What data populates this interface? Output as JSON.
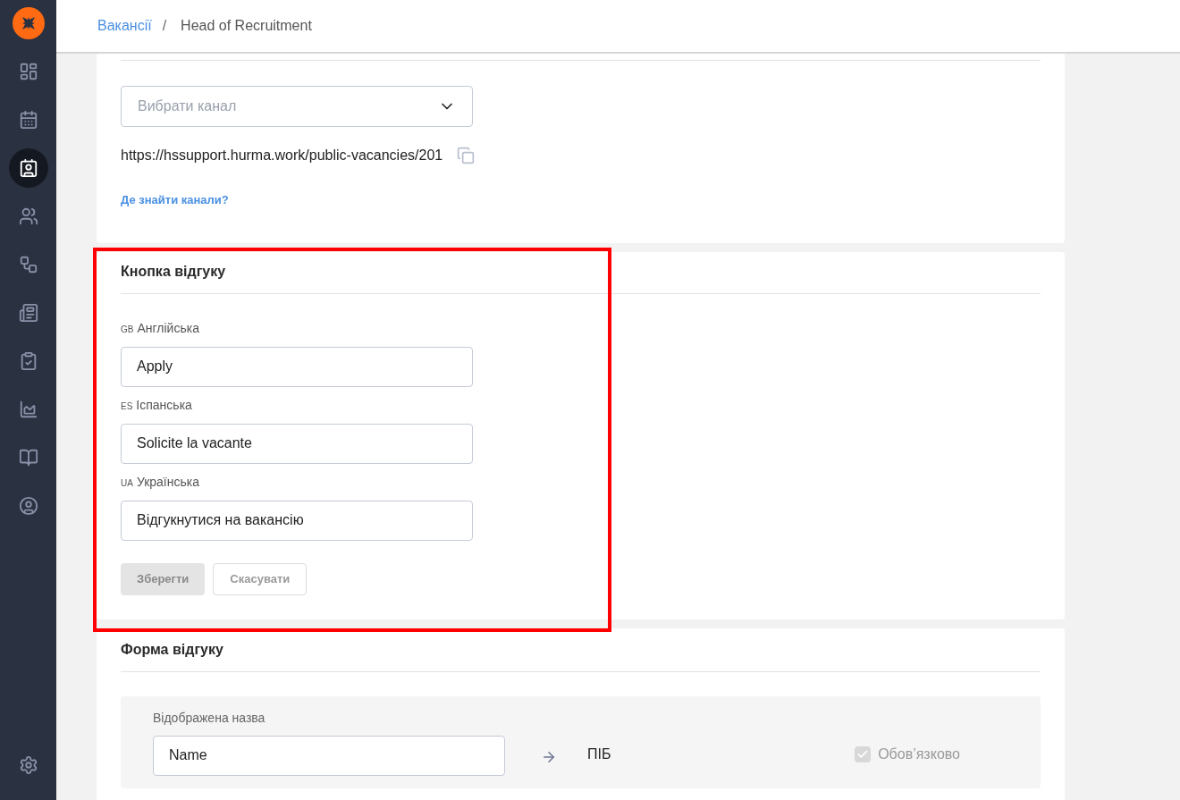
{
  "sidebar": {
    "items": [
      {
        "selected": false
      },
      {
        "selected": false
      },
      {
        "selected": true
      },
      {
        "selected": false
      },
      {
        "selected": false
      },
      {
        "selected": false
      },
      {
        "selected": false
      },
      {
        "selected": false
      },
      {
        "selected": false
      },
      {
        "selected": false
      }
    ]
  },
  "breadcrumb": {
    "link": "Вакансії",
    "separator": "/",
    "current": "Head of Recruitment"
  },
  "channels_card": {
    "select": {
      "placeholder": "Вибрати канал"
    },
    "url": "https://hssupport.hurma.work/public-vacancies/201",
    "help_link": "Де знайти канали?"
  },
  "button_card": {
    "title": "Кнопка відгуку",
    "highlighted": true,
    "fields": [
      {
        "code": "GB",
        "language": "Англійська",
        "value": "Apply"
      },
      {
        "code": "ES",
        "language": "Іспанська",
        "value": "Solicite la vacante"
      },
      {
        "code": "UA",
        "language": "Українська",
        "value": "Відгукнутися на вакансію"
      }
    ],
    "save": {
      "label": "Зберегти",
      "disabled": true
    },
    "cancel": {
      "label": "Скасувати",
      "disabled": true
    }
  },
  "form_card": {
    "title": "Форма відгуку",
    "rows": [
      {
        "label": "Відображена назва",
        "value": "Name",
        "field": "ПІБ",
        "required": {
          "label": "Обов’язково",
          "checked": true,
          "disabled": true
        }
      }
    ]
  }
}
